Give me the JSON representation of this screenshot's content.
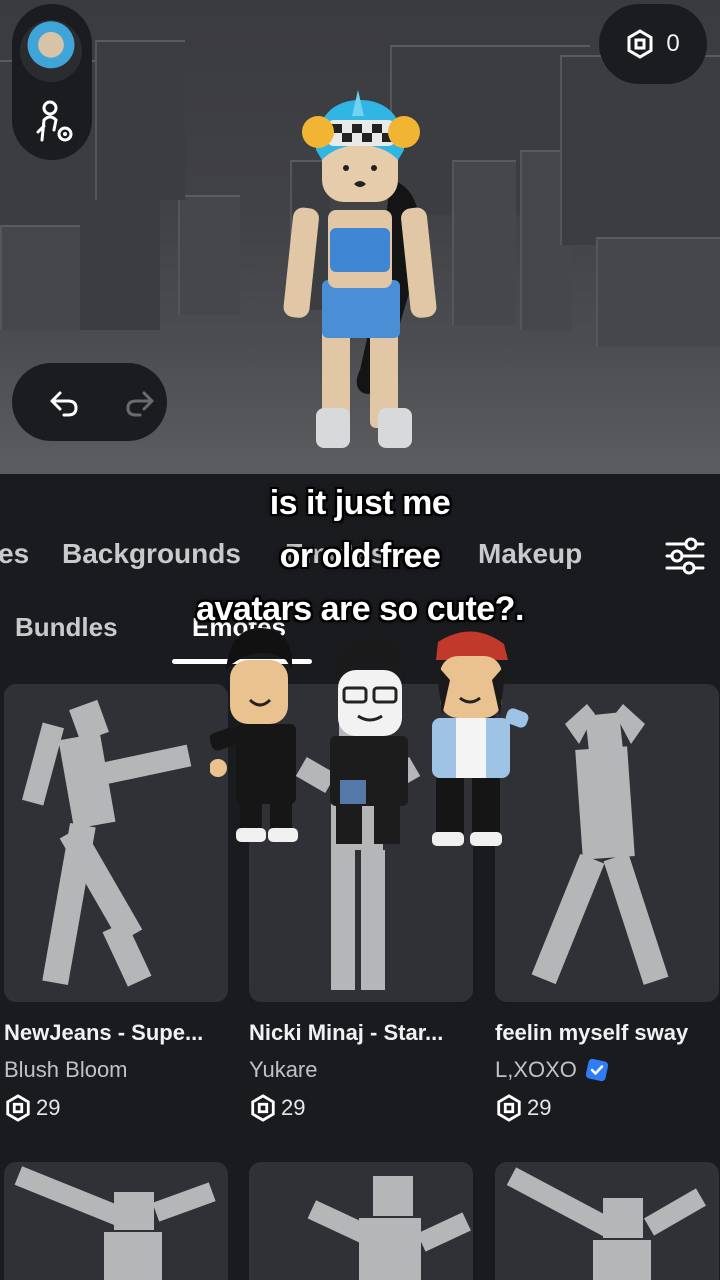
{
  "header": {
    "robux_balance": "0"
  },
  "category_tabs": [
    "es",
    "Backgrounds",
    "Emotes",
    "Makeup"
  ],
  "sub_tabs": [
    "Bundles",
    "Emotes"
  ],
  "caption_lines": [
    "is it just me",
    "or old free",
    "avatars are so cute?."
  ],
  "items": [
    {
      "name": "NewJeans - Supe...",
      "creator": "Blush Bloom",
      "price": "29",
      "verified": false
    },
    {
      "name": "Nicki Minaj - Star...",
      "creator": "Yukare",
      "price": "29",
      "verified": false
    },
    {
      "name": "feelin myself sway",
      "creator": "L,XOXO",
      "price": "29",
      "verified": true
    }
  ],
  "colors": {
    "background": "#1a1b1e",
    "card": "#303136",
    "silhouette": "#b5b6b8",
    "verified": "#2f7df6"
  },
  "icons": {
    "robux": "robux-icon",
    "avatar_settings": "avatar-settings-icon",
    "undo": "undo-icon",
    "redo": "redo-icon",
    "filter": "filter-sliders-icon"
  }
}
